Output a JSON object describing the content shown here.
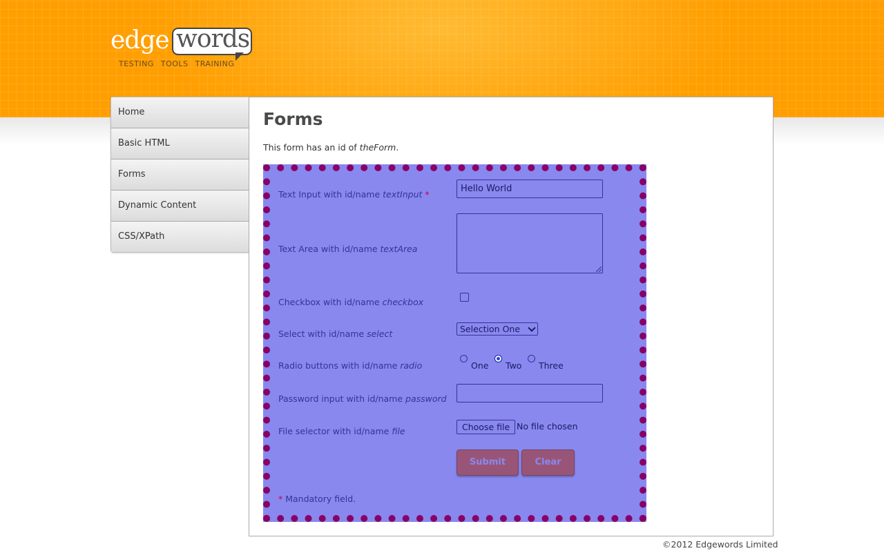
{
  "header": {
    "logo_part1": "edge",
    "logo_part2": "words",
    "tagline": "TESTING TOOLS TRAINING"
  },
  "sidebar": {
    "items": [
      {
        "label": "Home"
      },
      {
        "label": "Basic HTML"
      },
      {
        "label": "Forms"
      },
      {
        "label": "Dynamic Content"
      },
      {
        "label": "CSS/XPath"
      }
    ]
  },
  "main": {
    "title": "Forms",
    "intro_prefix": "This form has an id of ",
    "intro_id": "theForm",
    "intro_suffix": "."
  },
  "form": {
    "label_prefix_textinput": "Text Input with id/name ",
    "label_id_textinput": "textInput",
    "required_mark": "*",
    "textinput_value": "Hello World",
    "label_prefix_textarea": "Text Area with id/name ",
    "label_id_textarea": "textArea",
    "textarea_value": "",
    "label_prefix_checkbox": "Checkbox with id/name ",
    "label_id_checkbox": "checkbox",
    "checkbox_checked": false,
    "label_prefix_select": "Select with id/name ",
    "label_id_select": "select",
    "select_value": "Selection One",
    "label_prefix_radio": "Radio buttons with id/name ",
    "label_id_radio": "radio",
    "radio_options": [
      {
        "label": "One",
        "checked": false
      },
      {
        "label": "Two",
        "checked": true
      },
      {
        "label": "Three",
        "checked": false
      }
    ],
    "label_prefix_password": "Password input with id/name ",
    "label_id_password": "password",
    "password_value": "",
    "label_prefix_file": "File selector with id/name ",
    "label_id_file": "file",
    "file_button_label": "Choose file",
    "file_status": "No file chosen",
    "submit_label": "Submit",
    "clear_label": "Clear",
    "mandatory_star": "*",
    "mandatory_text": " Mandatory field."
  },
  "footer": {
    "copyright": "©2012 Edgewords Limited"
  },
  "colors": {
    "header_orange": "#ff9e00",
    "form_background": "#8888ee",
    "form_border": "#880066",
    "button_background": "#995577"
  }
}
